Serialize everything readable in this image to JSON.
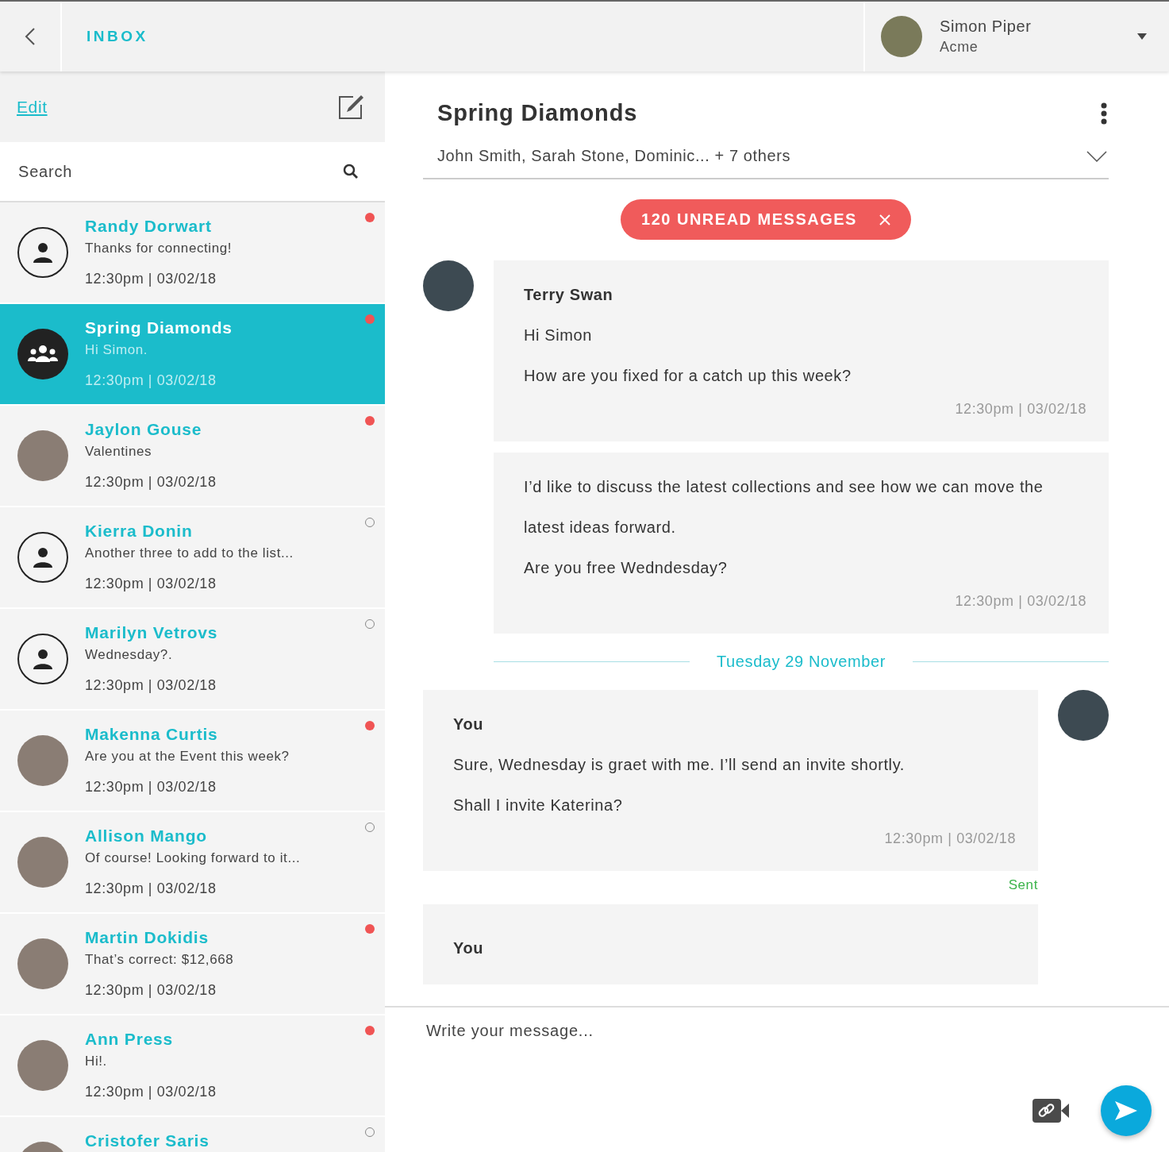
{
  "topbar": {
    "title": "INBOX",
    "user": {
      "name": "Simon Piper",
      "company": "Acme"
    }
  },
  "sidebar": {
    "edit": "Edit",
    "search": {
      "placeholder": "Search"
    },
    "conversations": [
      {
        "name": "Randy Dorwart",
        "preview": "Thanks for connecting!",
        "time": "12:30pm | 03/02/18",
        "kind": "icon",
        "unread": true,
        "selected": false
      },
      {
        "name": "Spring Diamonds",
        "preview": "Hi Simon.",
        "time": "12:30pm | 03/02/18",
        "kind": "group",
        "unread": true,
        "selected": true
      },
      {
        "name": "Jaylon Gouse",
        "preview": "Valentines",
        "time": "12:30pm | 03/02/18",
        "kind": "photo",
        "unread": true,
        "selected": false
      },
      {
        "name": "Kierra Donin",
        "preview": "Another three to add to the list...",
        "time": "12:30pm | 03/02/18",
        "kind": "icon",
        "unread": false,
        "selected": false
      },
      {
        "name": "Marilyn Vetrovs",
        "preview": "Wednesday?.",
        "time": "12:30pm | 03/02/18",
        "kind": "icon",
        "unread": false,
        "selected": false
      },
      {
        "name": "Makenna Curtis",
        "preview": "Are you at the Event this week?",
        "time": "12:30pm | 03/02/18",
        "kind": "photo",
        "unread": true,
        "selected": false
      },
      {
        "name": "Allison Mango",
        "preview": "Of course! Looking forward to it...",
        "time": "12:30pm | 03/02/18",
        "kind": "photo",
        "unread": false,
        "selected": false
      },
      {
        "name": "Martin Dokidis",
        "preview": "That’s correct: $12,668",
        "time": "12:30pm | 03/02/18",
        "kind": "photo",
        "unread": true,
        "selected": false
      },
      {
        "name": "Ann Press",
        "preview": "Hi!.",
        "time": "12:30pm | 03/02/18",
        "kind": "photo",
        "unread": true,
        "selected": false
      },
      {
        "name": "Cristofer Saris",
        "kind": "photo",
        "unread": false,
        "selected": false
      }
    ]
  },
  "chat": {
    "title": "Spring Diamonds",
    "participants": "John Smith, Sarah Stone, Dominic... + 7 others",
    "unread_banner": "120 UNREAD MESSAGES",
    "messages": [
      {
        "kind": "received",
        "sender": "Terry Swan",
        "paragraphs": [
          "Hi Simon",
          "How are you fixed for a catch up this week?"
        ],
        "time": "12:30pm | 03/02/18"
      },
      {
        "kind": "received",
        "paragraphs": [
          "I’d like to discuss the latest collections and see how we can move the latest ideas forward.",
          "Are you free Wedndesday?"
        ],
        "time": "12:30pm | 03/02/18"
      },
      {
        "kind": "divider",
        "text": "Tuesday 29 November"
      },
      {
        "kind": "sent",
        "sender": "You",
        "paragraphs": [
          "Sure, Wednesday is graet with me. I’ll send an invite shortly.",
          "Shall I invite Katerina?"
        ],
        "time": "12:30pm | 03/02/18",
        "status": "Sent"
      },
      {
        "kind": "sent",
        "sender": "You"
      }
    ],
    "composer": {
      "placeholder": "Write your message..."
    }
  }
}
